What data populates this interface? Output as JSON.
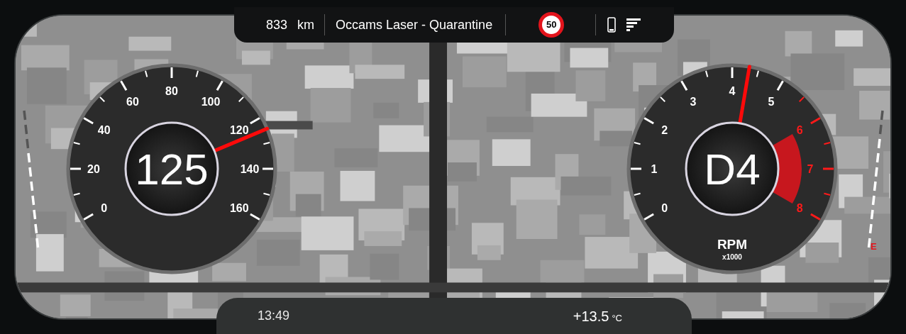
{
  "top_bar": {
    "distance": "833",
    "distance_unit": "km",
    "track": "Occams Laser - Quarantine",
    "speed_limit": "50"
  },
  "speedometer": {
    "reading": "125",
    "level": 0.78,
    "ticks": [
      {
        "label": "0",
        "redline": false
      },
      {
        "label": "20",
        "redline": false
      },
      {
        "label": "40",
        "redline": false
      },
      {
        "label": "60",
        "redline": false
      },
      {
        "label": "80",
        "redline": false
      },
      {
        "label": "100",
        "redline": false
      },
      {
        "label": "120",
        "redline": false
      },
      {
        "label": "140",
        "redline": false
      },
      {
        "label": "160",
        "redline": false
      }
    ]
  },
  "tachometer": {
    "reading": "D4",
    "unit": "RPM",
    "multiplier": "x1000",
    "level": 0.54,
    "ticks": [
      {
        "label": "0",
        "redline": false
      },
      {
        "label": "1",
        "redline": false
      },
      {
        "label": "2",
        "redline": false
      },
      {
        "label": "3",
        "redline": false
      },
      {
        "label": "4",
        "redline": false
      },
      {
        "label": "5",
        "redline": false
      },
      {
        "label": "6",
        "redline": true
      },
      {
        "label": "7",
        "redline": true
      },
      {
        "label": "8",
        "redline": true
      }
    ]
  },
  "left_scale": {
    "level": 0.7
  },
  "right_scale": {
    "level": 0.8,
    "label": "E"
  },
  "bottom_bar": {
    "time": "13:49",
    "temperature": "+13.5",
    "temperature_unit": "°C"
  }
}
